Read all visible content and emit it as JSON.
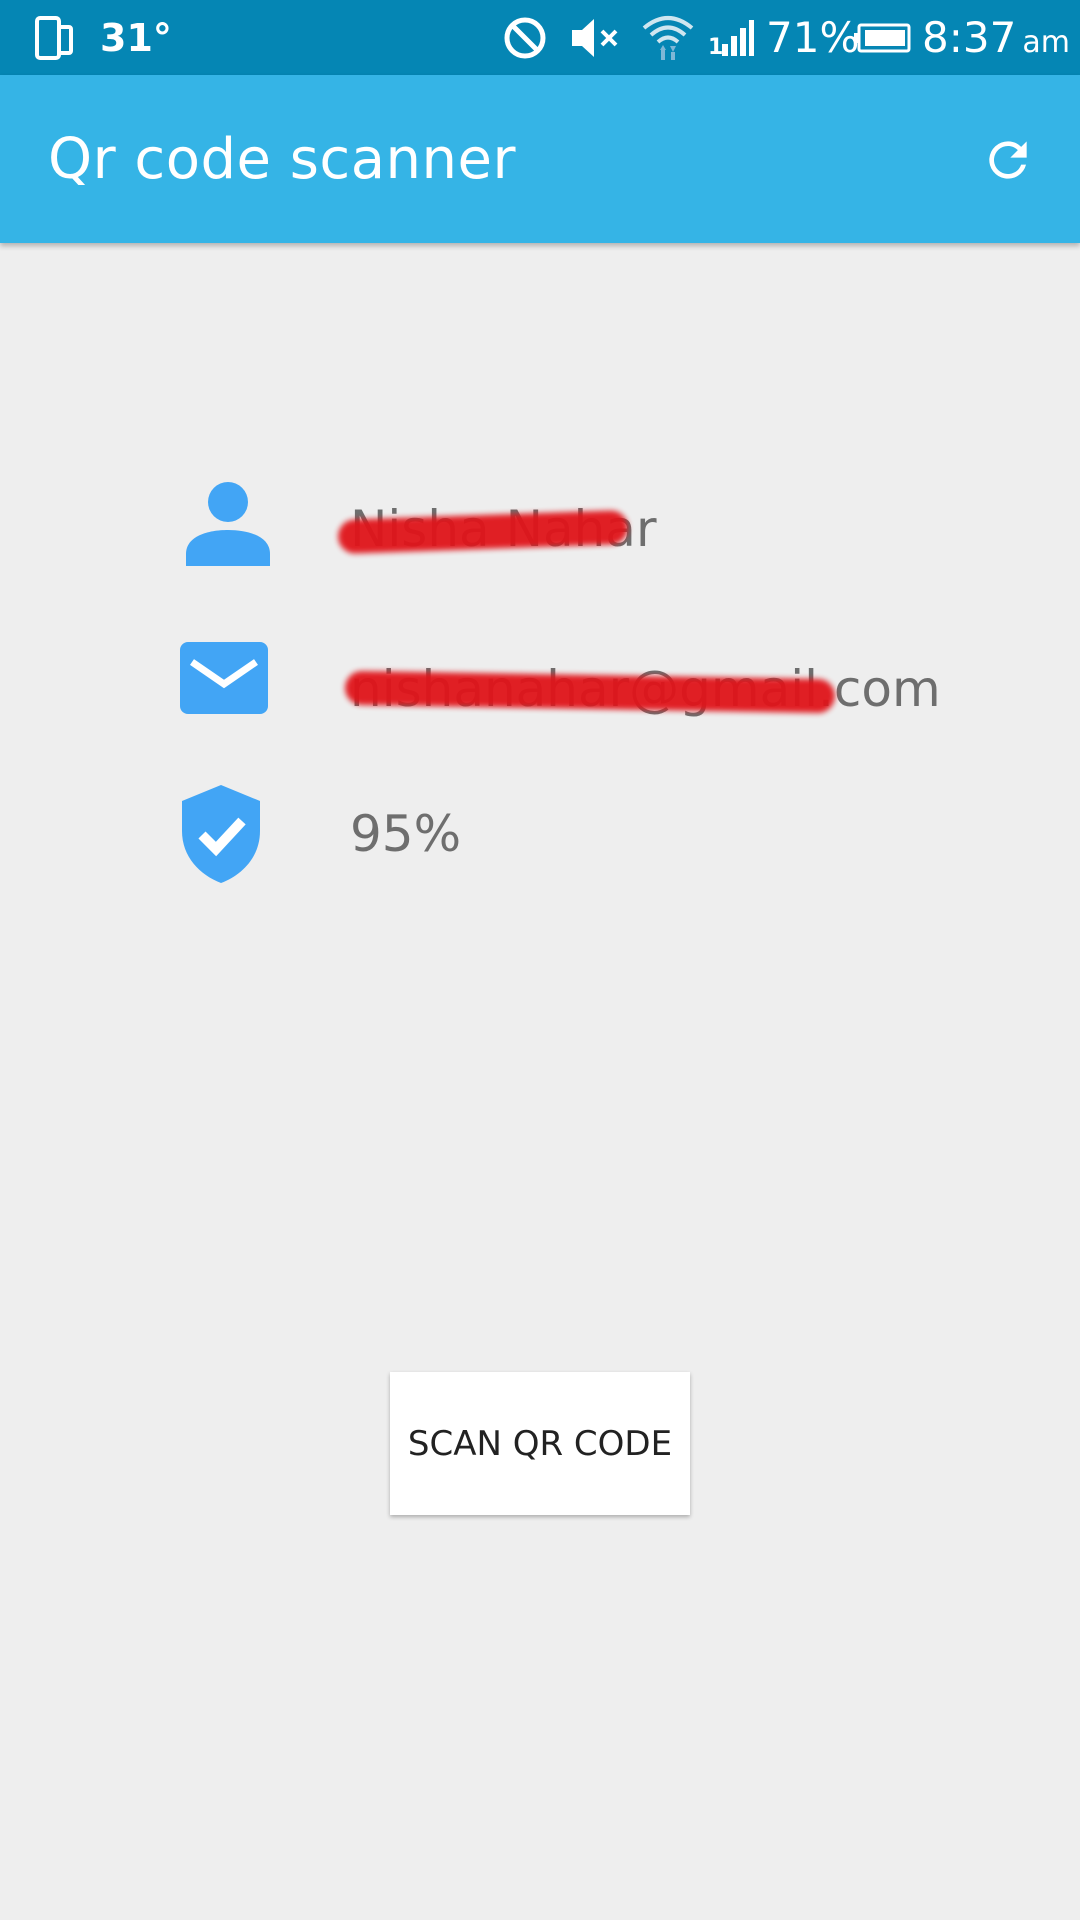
{
  "status_bar": {
    "temperature": "31°",
    "battery_percent": "71%",
    "time": "8:37",
    "ampm": "am",
    "icons": [
      "phone-tablet-icon",
      "do-not-disturb-icon",
      "mute-icon",
      "wifi-icon",
      "signal-icon",
      "battery-icon"
    ]
  },
  "app_bar": {
    "title": "Qr code scanner",
    "refresh_icon": "refresh-icon"
  },
  "profile": {
    "name": "Nisha Nahar",
    "email": "nishanahar@gmail.com",
    "score": "95%",
    "icons": [
      "person-icon",
      "email-icon",
      "verified-shield-icon"
    ]
  },
  "actions": {
    "scan_label": "SCAN QR CODE"
  },
  "colors": {
    "status_bar": "#0586b4",
    "app_bar": "#35b4e6",
    "icon_blue": "#42a5f5",
    "background": "#eeeeee",
    "redaction": "#e0141a"
  }
}
